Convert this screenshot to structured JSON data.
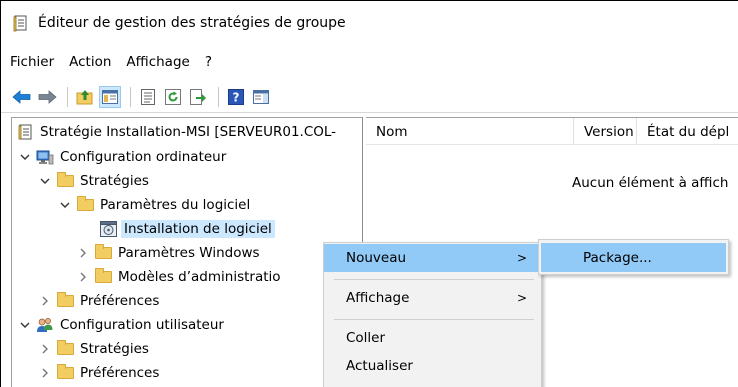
{
  "window": {
    "title": "Éditeur de gestion des stratégies de groupe"
  },
  "menubar": {
    "items": [
      "Fichier",
      "Action",
      "Affichage",
      "?"
    ]
  },
  "toolbar": {
    "icons": [
      "back-arrow-icon",
      "forward-arrow-icon",
      "up-folder-icon",
      "show-hide-tree-icon",
      "properties-icon",
      "refresh-icon",
      "export-list-icon",
      "help-icon",
      "action-pane-icon"
    ]
  },
  "tree": {
    "items": [
      {
        "label": "Stratégie Installation-MSI [SERVEUR01.COL-",
        "expanded": null
      },
      {
        "label": "Configuration ordinateur",
        "expanded": true
      },
      {
        "label": "Stratégies",
        "expanded": true
      },
      {
        "label": "Paramètres du logiciel",
        "expanded": true
      },
      {
        "label": "Installation de logiciel",
        "expanded": null,
        "selected": true
      },
      {
        "label": "Paramètres Windows",
        "expanded": false
      },
      {
        "label": "Modèles d’administratio",
        "expanded": false
      },
      {
        "label": "Préférences",
        "expanded": false
      },
      {
        "label": "Configuration utilisateur",
        "expanded": true
      },
      {
        "label": "Stratégies",
        "expanded": false
      },
      {
        "label": "Préférences",
        "expanded": false
      }
    ]
  },
  "list": {
    "columns": [
      "Nom",
      "Version",
      "État du dépl"
    ],
    "empty_message": "Aucun élément à affich"
  },
  "context_menu": {
    "items": [
      {
        "label": "Nouveau",
        "has_submenu": true,
        "highlighted": true
      },
      {
        "label": "Affichage",
        "has_submenu": true,
        "highlighted": false
      },
      {
        "label": "Coller",
        "has_submenu": false,
        "highlighted": false
      },
      {
        "label": "Actualiser",
        "has_submenu": false,
        "highlighted": false
      }
    ],
    "submenu_arrow": ">"
  },
  "submenu": {
    "items": [
      {
        "label": "Package...",
        "highlighted": true
      }
    ]
  },
  "colors": {
    "selection": "#cce8ff",
    "menu_highlight": "#91c9f7",
    "folder": "#f2cd61"
  }
}
